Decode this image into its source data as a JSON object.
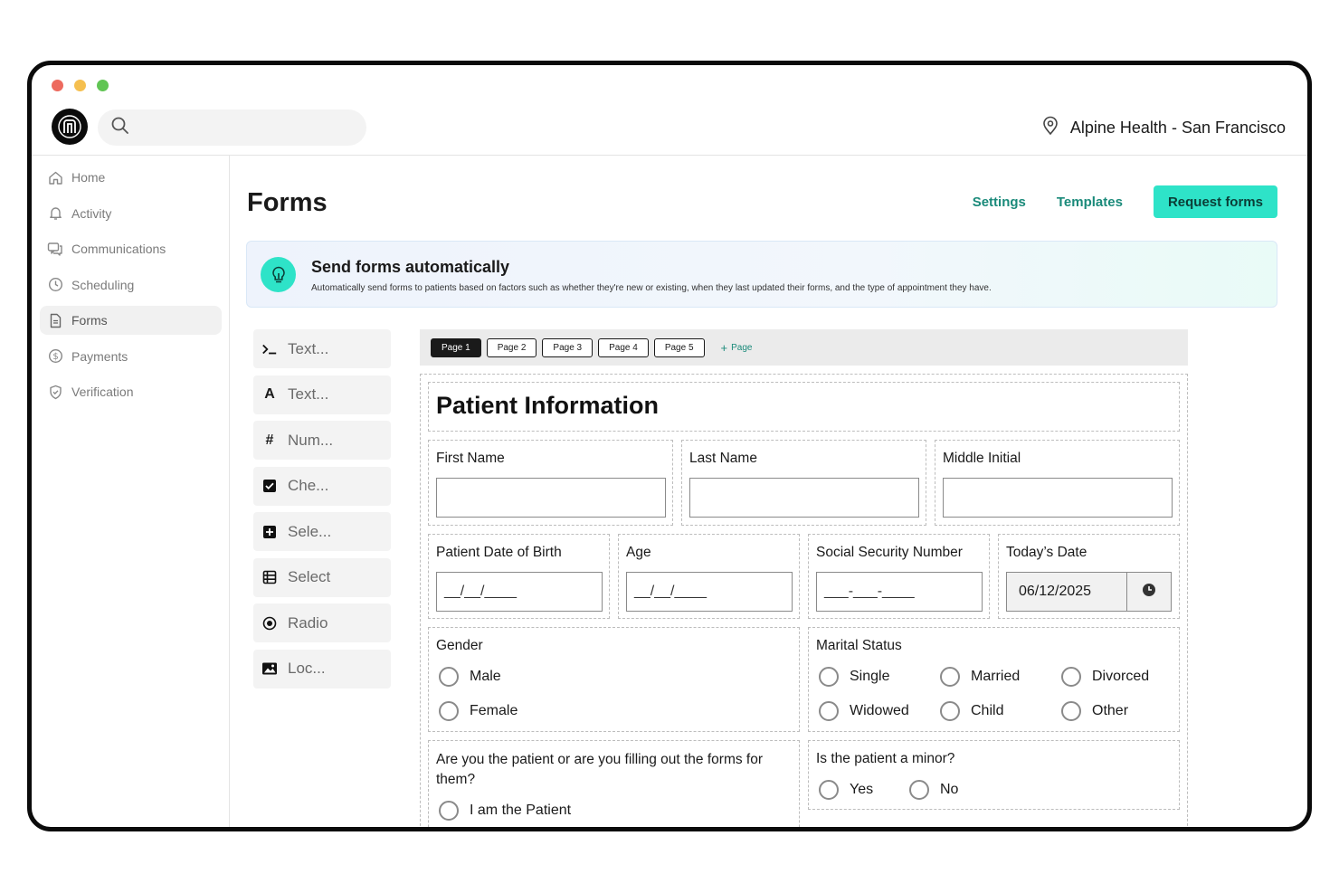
{
  "window": {
    "colors": {
      "close": "#ed6a5e",
      "minimize": "#f5bf4f",
      "zoom": "#61c554"
    }
  },
  "header": {
    "logo_icon": "brand-logo-icon",
    "search_icon": "search-icon",
    "search_placeholder": "",
    "location_icon": "map-pin-icon",
    "location": "Alpine Health - San Francisco"
  },
  "sidebar": {
    "items": [
      {
        "label": "Home",
        "icon": "home-icon"
      },
      {
        "label": "Activity",
        "icon": "bell-icon"
      },
      {
        "label": "Communications",
        "icon": "chat-icon"
      },
      {
        "label": "Scheduling",
        "icon": "clock-icon"
      },
      {
        "label": "Forms",
        "icon": "document-icon",
        "active": true
      },
      {
        "label": "Payments",
        "icon": "dollar-icon"
      },
      {
        "label": "Verification",
        "icon": "shield-icon"
      }
    ]
  },
  "page": {
    "title": "Forms",
    "actions": {
      "settings": "Settings",
      "templates": "Templates",
      "request": "Request forms"
    },
    "accent": "#2ee3c8",
    "link_color": "#1a8a7a"
  },
  "banner": {
    "icon": "lightbulb-icon",
    "title": "Send forms automatically",
    "description": "Automatically send forms to patients based on factors such as whether they're new or existing, when they last updated their forms, and the type of appointment they have."
  },
  "tools": [
    {
      "label": "Text...",
      "icon": "terminal-icon"
    },
    {
      "label": "Text...",
      "icon": "letter-a-icon"
    },
    {
      "label": "Num...",
      "icon": "hash-icon"
    },
    {
      "label": "Che...",
      "icon": "checkbox-icon"
    },
    {
      "label": "Sele...",
      "icon": "plus-square-icon"
    },
    {
      "label": "Select",
      "icon": "list-table-icon"
    },
    {
      "label": "Radio",
      "icon": "radio-icon"
    },
    {
      "label": "Loc...",
      "icon": "image-icon"
    }
  ],
  "pages": {
    "tabs": [
      "Page 1",
      "Page 2",
      "Page 3",
      "Page 4",
      "Page 5"
    ],
    "active": "Page 1",
    "add_label": "Page"
  },
  "form": {
    "title": "Patient Information",
    "first_name": {
      "label": "First Name",
      "value": ""
    },
    "last_name": {
      "label": "Last Name",
      "value": ""
    },
    "middle_initial": {
      "label": "Middle Initial",
      "value": ""
    },
    "dob": {
      "label": "Patient Date of Birth",
      "placeholder": "__/__/____"
    },
    "age": {
      "label": "Age",
      "placeholder": "__/__/____"
    },
    "ssn": {
      "label": "Social Security Number",
      "placeholder": "___-___-____"
    },
    "today": {
      "label": "Today’s Date",
      "value": "06/12/2025",
      "icon": "clock-filled-icon"
    },
    "gender": {
      "label": "Gender",
      "options": [
        "Male",
        "Female"
      ]
    },
    "marital": {
      "label": "Marital Status",
      "options": [
        "Single",
        "Married",
        "Divorced",
        "Widowed",
        "Child",
        "Other"
      ]
    },
    "filler": {
      "label": "Are you the patient or are you filling out the forms for them?",
      "options": [
        "I am the Patient"
      ]
    },
    "minor": {
      "label": "Is the patient a minor?",
      "options": [
        "Yes",
        "No"
      ]
    }
  }
}
